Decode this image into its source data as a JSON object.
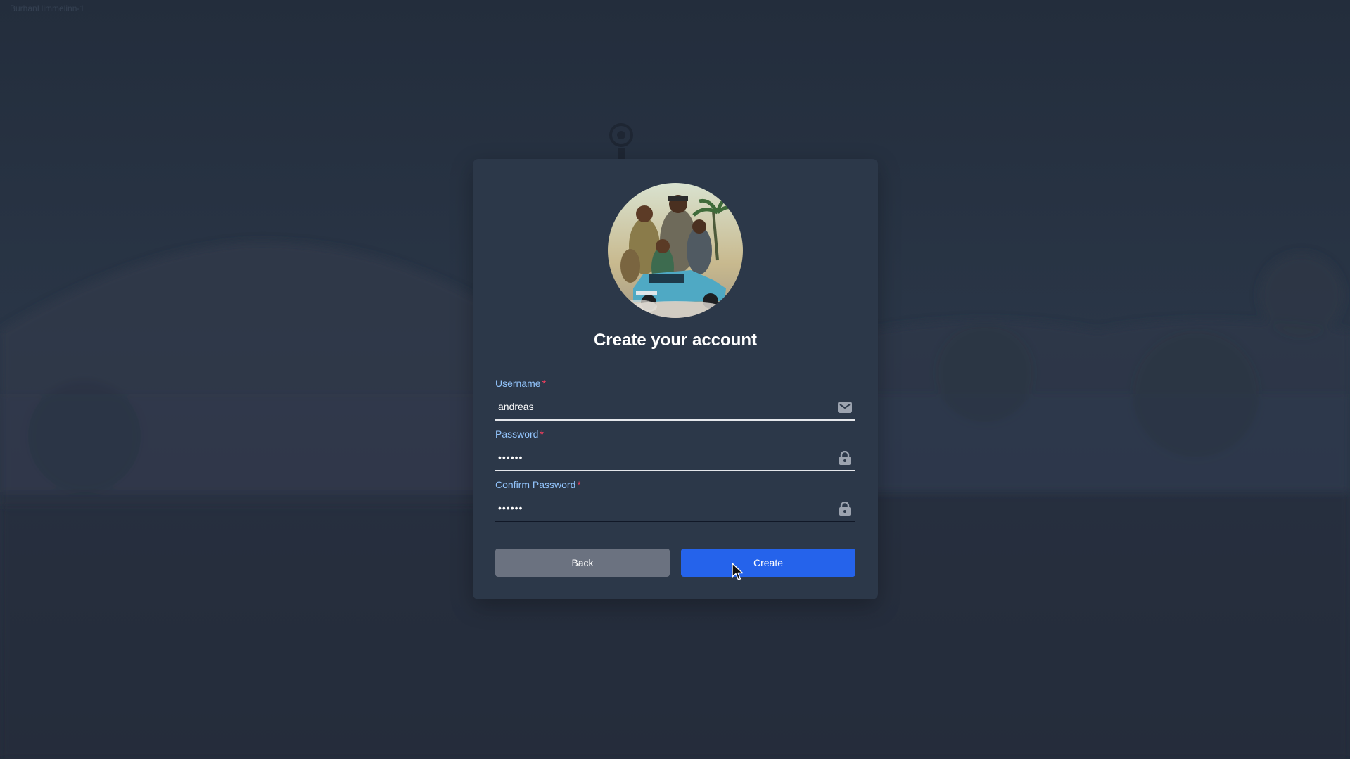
{
  "background": {
    "corner_text": "BurhanHimmelinn-1"
  },
  "card": {
    "title": "Create your account",
    "avatar_alt": "avatar-artwork"
  },
  "form": {
    "username": {
      "label": "Username",
      "required_mark": "*",
      "value": "andreas",
      "icon": "envelope-icon"
    },
    "password": {
      "label": "Password",
      "required_mark": "*",
      "value": "123456",
      "icon": "lock-icon"
    },
    "confirm_password": {
      "label": "Confirm Password",
      "required_mark": "*",
      "value": "123456",
      "icon": "lock-icon"
    }
  },
  "buttons": {
    "back_label": "Back",
    "create_label": "Create"
  },
  "colors": {
    "label": "#93c5fd",
    "required": "#f43f5e",
    "create_button": "#2563eb",
    "back_button": "#6b7280",
    "card": "#2c3849",
    "page": "#263142"
  }
}
